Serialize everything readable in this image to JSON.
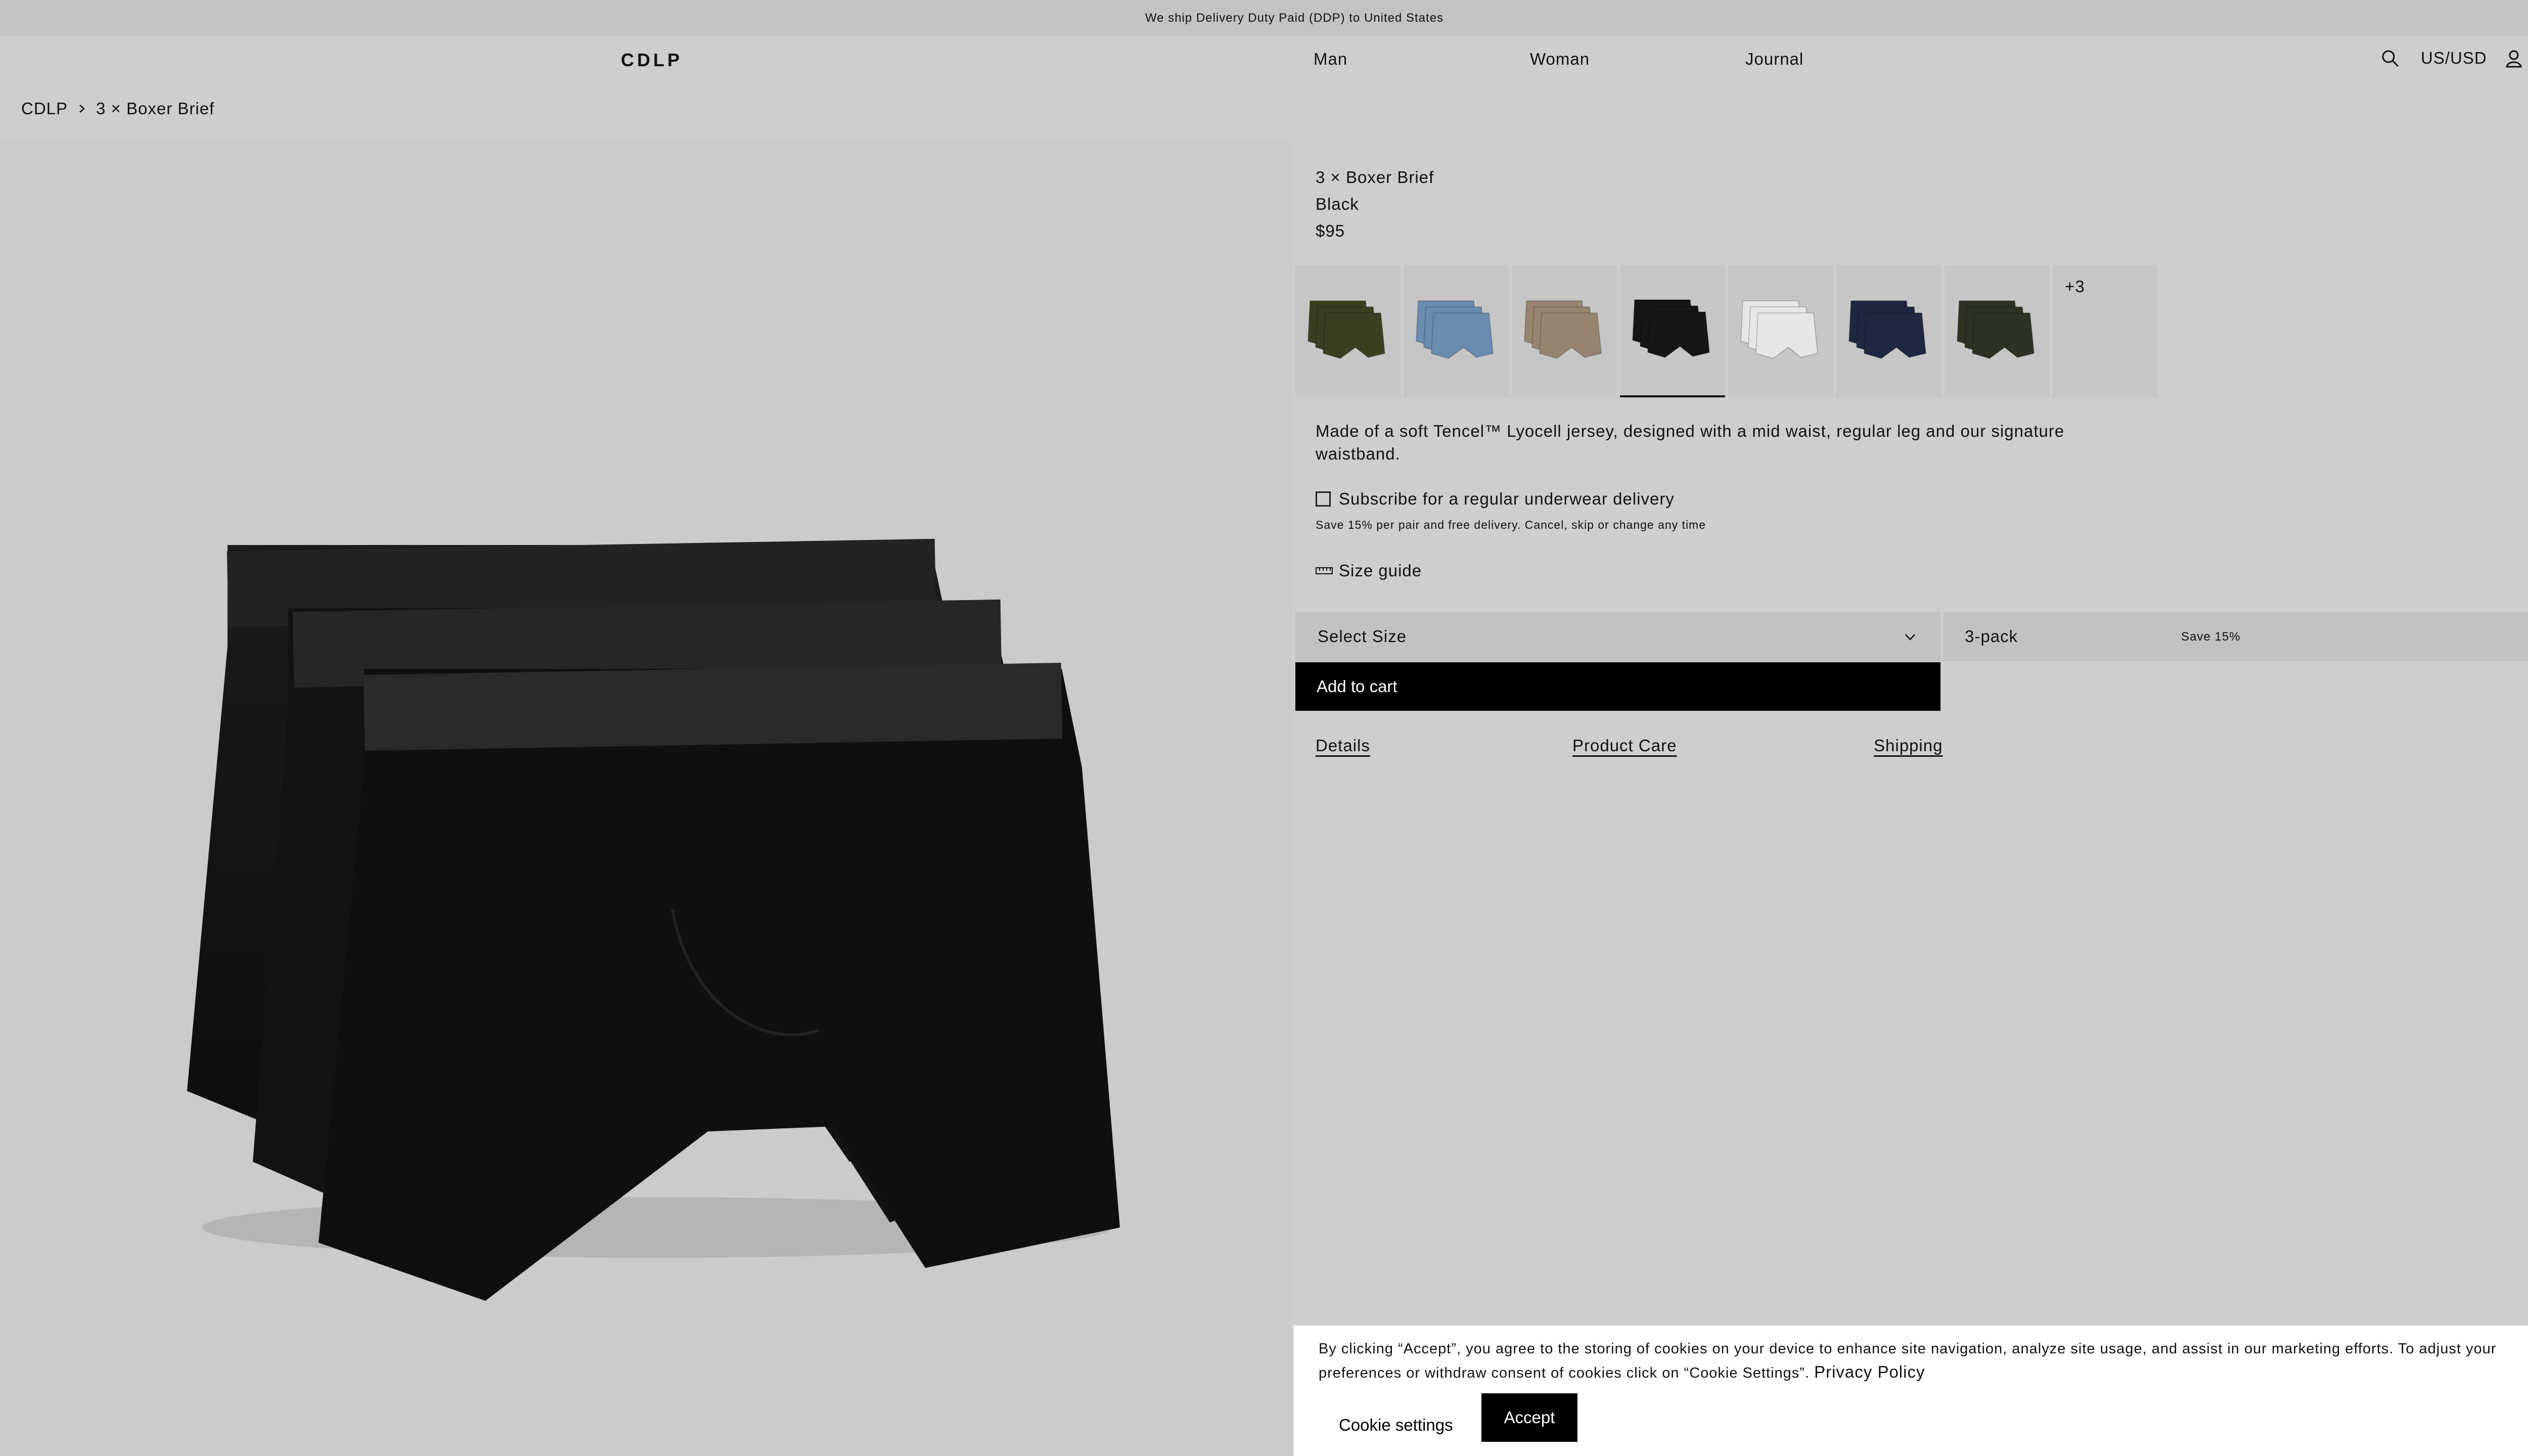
{
  "announcement": {
    "text": "We ship Delivery Duty Paid (DDP) to United States"
  },
  "header": {
    "logo": "CDLP",
    "nav": [
      "Man",
      "Woman",
      "Journal"
    ],
    "currency": "US/USD"
  },
  "breadcrumb": [
    "CDLP",
    "3 × Boxer Brief"
  ],
  "product": {
    "name": "3 × Boxer Brief",
    "color": "Black",
    "price": "$95",
    "swatch_colors": [
      "#3a3f22",
      "#6b8bb0",
      "#958570",
      "#151515",
      "#e6e6e6",
      "#1e2840",
      "#2c3322"
    ],
    "selected_swatch_index": 3,
    "more_swatches": "+3",
    "description": "Made of a soft Tencel™ Lyocell jersey, designed with a mid waist, regular leg and our signature waistband.",
    "subscribe_label": "Subscribe for a regular underwear delivery",
    "subscribe_note": "Save 15% per pair and free delivery. Cancel, skip or change any time",
    "size_guide": "Size guide",
    "size_select": "Select Size",
    "pack_select": "3-pack",
    "pack_save": "Save 15%",
    "add_to_cart": "Add to cart",
    "tabs": [
      "Details",
      "Product Care",
      "Shipping"
    ]
  },
  "cookie": {
    "text": "By clicking “Accept”, you agree to the storing of cookies on your device to enhance site navigation, analyze site usage, and assist in our marketing efforts. To adjust your preferences or withdraw consent of cookies click on “Cookie Settings”.",
    "policy_link": "Privacy Policy",
    "settings_label": "Cookie settings",
    "accept_label": "Accept"
  },
  "colors": {
    "background": "#cecece",
    "banner": "#c3c3c3",
    "cta": "#000000"
  },
  "icons": [
    "close-icon",
    "search-icon",
    "account-icon",
    "bag-icon",
    "chevron-right-icon",
    "chevron-down-icon",
    "ruler-icon"
  ]
}
